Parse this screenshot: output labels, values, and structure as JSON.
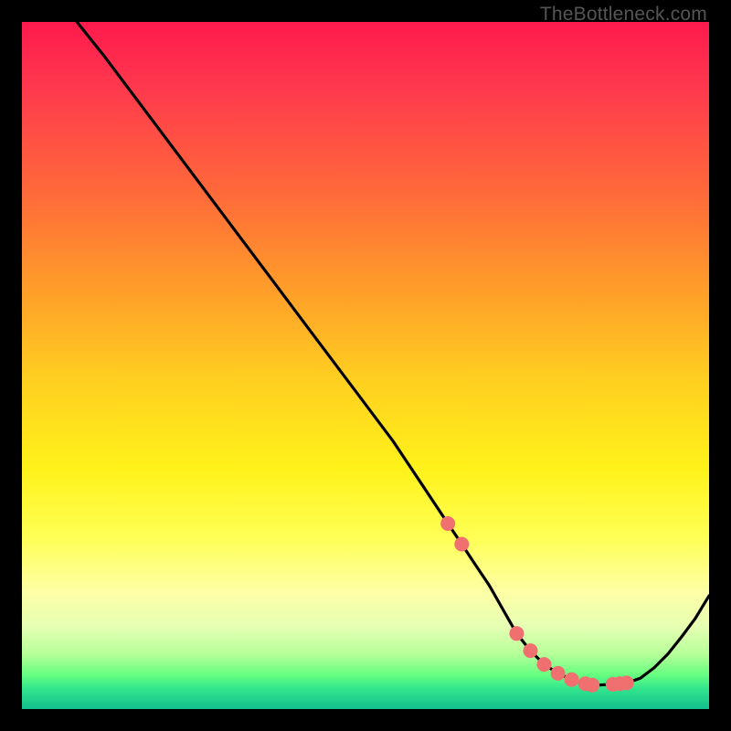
{
  "watermark": "TheBottleneck.com",
  "chart_data": {
    "type": "line",
    "title": "",
    "xlabel": "",
    "ylabel": "",
    "xlim": [
      0,
      100
    ],
    "ylim": [
      0,
      100
    ],
    "series": [
      {
        "name": "curve",
        "x": [
          8,
          12,
          18,
          24,
          30,
          36,
          42,
          48,
          54,
          58,
          62,
          64,
          66,
          68,
          70,
          72,
          74,
          76,
          78,
          80,
          82,
          83,
          84,
          86,
          88,
          90,
          92,
          94,
          96,
          98,
          100
        ],
        "y": [
          100,
          95,
          87,
          79,
          71,
          63,
          55,
          47,
          39,
          33,
          27,
          24,
          21,
          18,
          14.5,
          11,
          8.5,
          6.5,
          5.2,
          4.3,
          3.7,
          3.5,
          3.5,
          3.6,
          3.8,
          4.5,
          6.0,
          8.0,
          10.5,
          13.2,
          16.5
        ]
      }
    ],
    "points": {
      "name": "markers",
      "x": [
        62,
        64,
        72,
        74,
        76,
        78,
        80,
        82,
        83,
        86,
        87,
        88
      ],
      "y": [
        27,
        24,
        11,
        8.5,
        6.5,
        5.2,
        4.3,
        3.7,
        3.5,
        3.6,
        3.7,
        3.8
      ]
    },
    "point_color": "#f07070",
    "line_color": "#000000",
    "background": "heatmap-gradient"
  }
}
